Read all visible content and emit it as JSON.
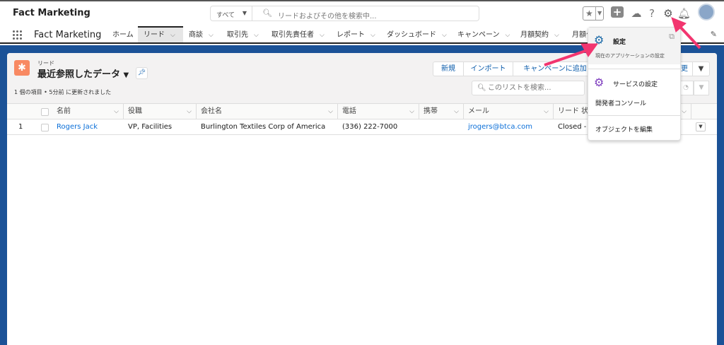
{
  "header": {
    "title": "Fact Marketing",
    "search_scope": "すべて",
    "search_placeholder": "リードおよびその他を検索中...",
    "icons": [
      "favorites-star-icon",
      "add-icon",
      "trailhead-icon",
      "help-icon",
      "setup-gear-icon",
      "notification-bell-icon",
      "avatar"
    ]
  },
  "nav": {
    "app_name": "Fact Marketing",
    "tabs": [
      {
        "label": "ホーム"
      },
      {
        "label": "リード",
        "active": true
      },
      {
        "label": "商談"
      },
      {
        "label": "取引先"
      },
      {
        "label": "取引先責任者"
      },
      {
        "label": "レポート"
      },
      {
        "label": "ダッシュボード"
      },
      {
        "label": "キャンペーン"
      },
      {
        "label": "月額契約"
      },
      {
        "label": "月額ᐟ"
      }
    ]
  },
  "list": {
    "object_label": "リード",
    "list_name": "最近参照したデータ",
    "meta": "1 個の項目 • 5分前 に更新されました",
    "buttons": [
      "新規",
      "インポート",
      "キャンペーンに追加",
      "更"
    ],
    "search_placeholder": "このリストを検索...",
    "columns": [
      "名前",
      "役職",
      "会社名",
      "電話",
      "携帯",
      "メール",
      "リード 状況"
    ],
    "rows": [
      {
        "num": "1",
        "name": "Rogers Jack",
        "title": "VP, Facilities",
        "company": "Burlington Textiles Corp of America",
        "phone": "(336) 222-7000",
        "mobile": "",
        "email": "jrogers@btca.com",
        "status": "Closed - C"
      }
    ]
  },
  "setup_menu": {
    "items": [
      {
        "label": "設定",
        "sub": "現在のアプリケーションの設定"
      },
      {
        "label": "サービスの設定"
      },
      {
        "label": "開発者コンソール"
      },
      {
        "label": "オブジェクトを編集"
      }
    ]
  },
  "colors": {
    "brand_blue": "#1b5297",
    "link": "#0b6fd8",
    "lead_icon": "#f88962",
    "annotation_arrow": "#f2356f"
  }
}
